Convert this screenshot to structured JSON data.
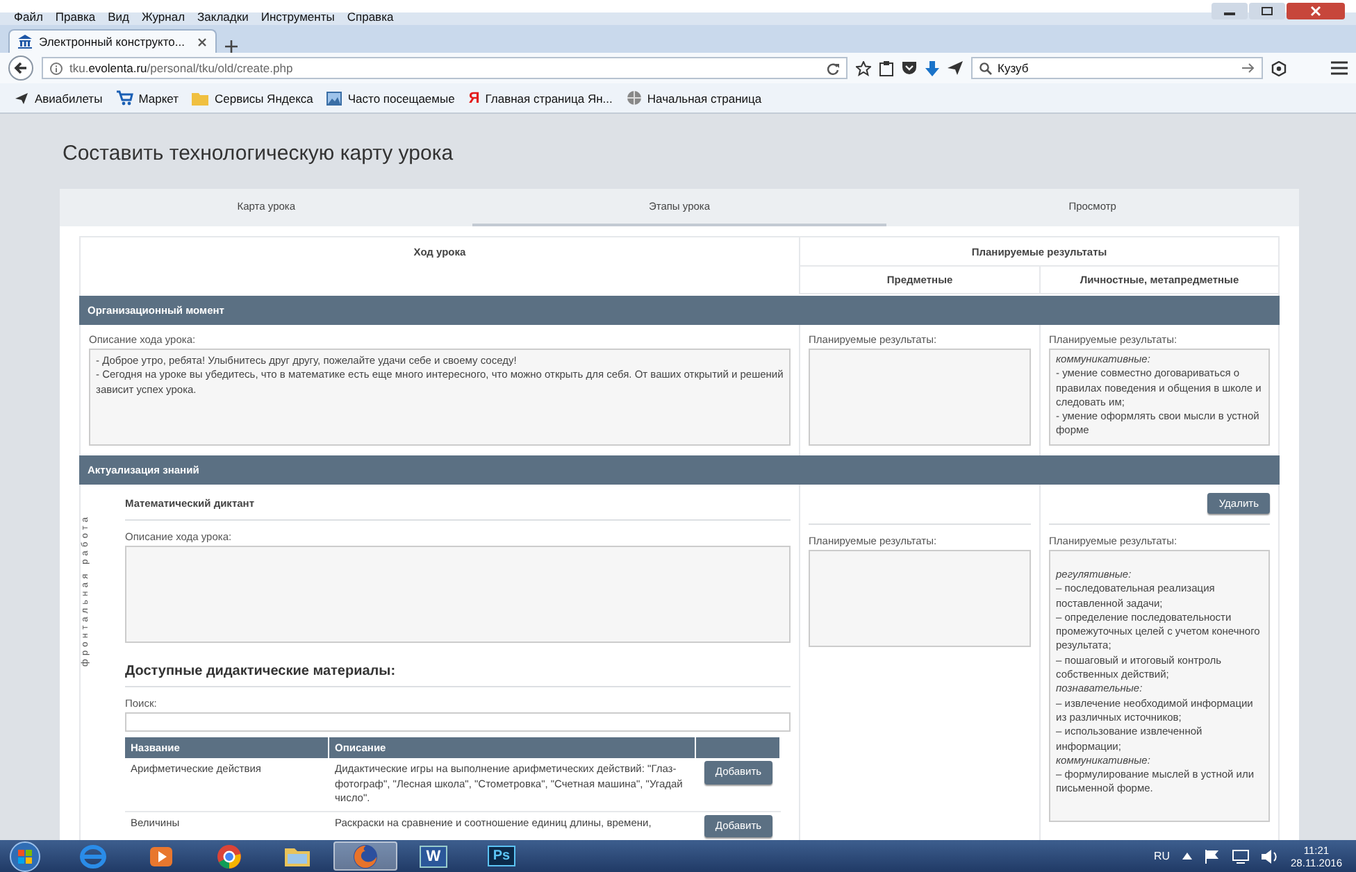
{
  "menu": [
    "Файл",
    "Правка",
    "Вид",
    "Журнал",
    "Закладки",
    "Инструменты",
    "Справка"
  ],
  "browser_tabs": [
    {
      "title": "Электронный конструкто...",
      "selected": true
    }
  ],
  "address_bar": {
    "url": "tku.**evolenta.ru**/personal/tku/old/create.php"
  },
  "search_field": {
    "value": "Кузуб"
  },
  "bookmarks": [
    {
      "kind": "plane",
      "label": "Авиабилеты"
    },
    {
      "kind": "cart",
      "label": "Маркет"
    },
    {
      "kind": "folder",
      "label": "Сервисы Яндекса"
    },
    {
      "kind": "picture",
      "label": "Часто посещаемые"
    },
    {
      "kind": "letter",
      "icon_text": "Я",
      "label": "Главная страница Ян..."
    },
    {
      "kind": "globe",
      "label": "Начальная страница"
    }
  ],
  "page": {
    "title": "Составить технологическую карту урока",
    "tabs": [
      {
        "label": "Карта урока",
        "selected": false
      },
      {
        "label": "Этапы урока",
        "selected": true
      },
      {
        "label": "Просмотр",
        "selected": false
      }
    ],
    "table": {
      "columns": {
        "progress": "Ход урока",
        "results": "Планируемые результаты",
        "subject": "Предметные",
        "personal": "Личностные, метапредметные"
      }
    },
    "sections": [
      {
        "kind": "text",
        "title": "Организационный момент",
        "description_label": "Описание хода урока:",
        "description": [
          "- Доброе утро, ребята! Улыбнитесь друг другу, пожелайте удачи себе и своему соседу!",
          "- Сегодня на уроке вы убедитесь, что в математике есть еще много интересного, что можно открыть для себя. От ваших открытий и решений зависит успех урока."
        ],
        "subject_label": "Планируемые результаты:",
        "personal_label": "Планируемые результаты:",
        "personal": [
          {
            "kind": "heading",
            "text": "коммуникативные:"
          },
          {
            "kind": "item",
            "text": "- умение совместно договариваться о правилах поведения и общения в школе и следовать им;"
          },
          {
            "kind": "item",
            "text": "- умение оформлять свои мысли в устной форме"
          }
        ]
      },
      {
        "kind": "activity",
        "title": "Актуализация знаний",
        "form": "фронтальная работа",
        "activity": "Математический диктант",
        "delete_button": "Удалить",
        "description_label": "Описание хода урока:",
        "materials_title": "Доступные дидактические материалы:",
        "search_label": "Поиск:",
        "materials_columns": [
          "Название",
          "Описание"
        ],
        "materials": [
          {
            "name": "Арифметические действия",
            "description": "Дидактические игры на выполнение арифметических действий: \"Глаз-фотограф\", \"Лесная школа\", \"Стометровка\", \"Счетная машина\", \"Угадай число\".",
            "button": "Добавить"
          },
          {
            "name": "Величины",
            "description": "Раскраски на сравнение и соотношение единиц длины, времени,",
            "button": "Добавить"
          }
        ],
        "subject_label": "Планируемые результаты:",
        "personal_label": "Планируемые результаты:",
        "personal": [
          {
            "kind": "heading",
            "text": "регулятивные:"
          },
          {
            "kind": "item",
            "text": "– последовательная реализация поставленной задачи;"
          },
          {
            "kind": "item",
            "text": "– определение последовательности промежуточных целей с учетом конечного результата;"
          },
          {
            "kind": "item",
            "text": "– пошаговый и итоговый контроль собственных действий;"
          },
          {
            "kind": "heading",
            "text": "познавательные:"
          },
          {
            "kind": "item",
            "text": "– извлечение необходимой информации из различных источников;"
          },
          {
            "kind": "item",
            "text": "– использование извлеченной информации;"
          },
          {
            "kind": "heading",
            "text": "коммуникативные:"
          },
          {
            "kind": "item",
            "text": "– формулирование мыслей в устной или письменной форме."
          }
        ]
      }
    ]
  },
  "taskbar": {
    "apps": [
      {
        "kind": "ie",
        "selected": false
      },
      {
        "kind": "media",
        "selected": false
      },
      {
        "kind": "chrome",
        "selected": false
      },
      {
        "kind": "explorer",
        "selected": false
      },
      {
        "kind": "firefox",
        "selected": true
      },
      {
        "kind": "word",
        "label": "W",
        "selected": false
      },
      {
        "kind": "photoshop",
        "label": "Ps",
        "selected": false
      }
    ],
    "language": "RU",
    "time": "11:21",
    "date": "28.11.2016"
  }
}
